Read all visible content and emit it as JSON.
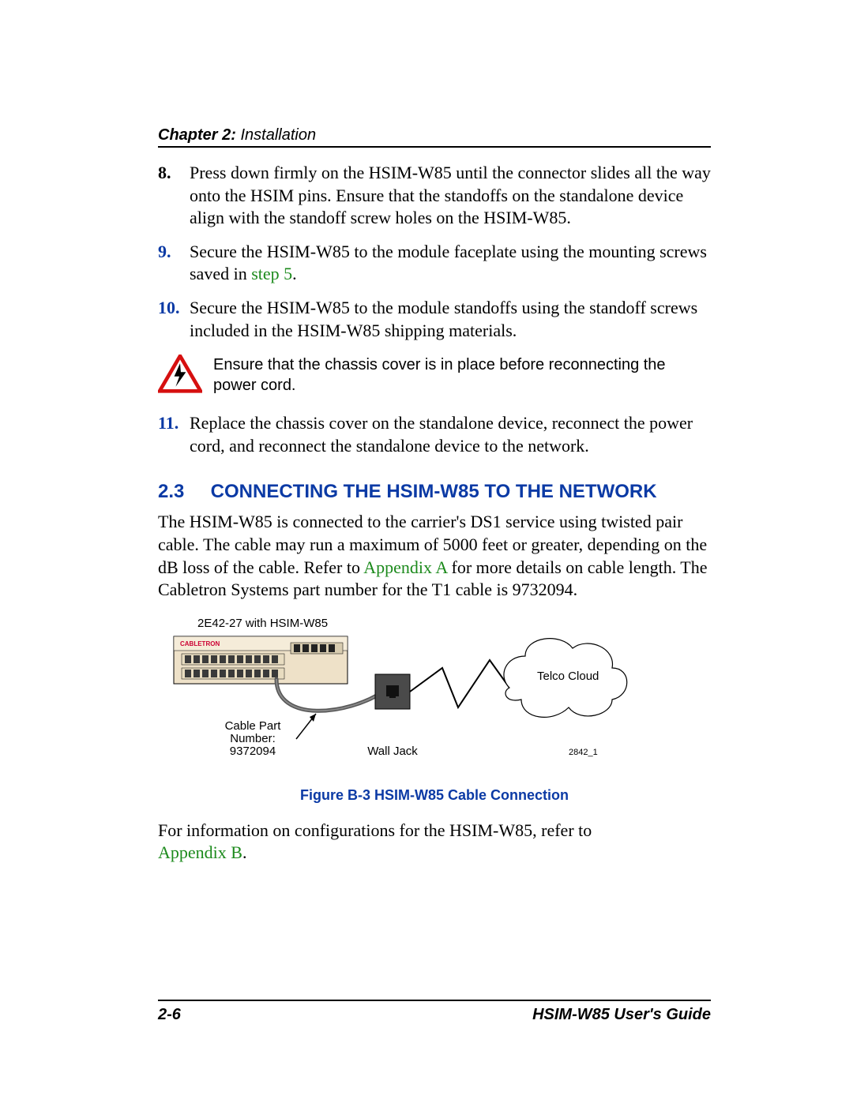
{
  "header": {
    "chapter": "Chapter 2:",
    "title": "Installation"
  },
  "steps": [
    {
      "num": "8.",
      "color": "black",
      "text": "Press down firmly on the HSIM-W85 until the connector slides all the way onto the HSIM pins. Ensure that the standoffs on the standalone device align with the standoff screw holes on the HSIM-W85."
    },
    {
      "num": "9.",
      "color": "blue",
      "text_before": "Secure the HSIM-W85 to the module faceplate using the mounting screws saved in ",
      "link": "step 5",
      "text_after": "."
    },
    {
      "num": "10.",
      "color": "blue",
      "text": "Secure the HSIM-W85 to the module standoffs using the standoff screws included in the HSIM-W85 shipping materials."
    }
  ],
  "warning": "Ensure that the chassis cover is in place before reconnecting the power cord.",
  "step11": {
    "num": "11.",
    "text": "Replace the chassis cover on the standalone device, reconnect the power cord, and reconnect the standalone device to the network."
  },
  "section": {
    "num": "2.3",
    "title": "CONNECTING THE HSIM-W85 TO THE NETWORK"
  },
  "section_para": {
    "before": "The HSIM-W85 is connected to the carrier's DS1 service using twisted pair cable. The cable may run a maximum of 5000 feet or greater, depending on the dB loss of the cable. Refer to ",
    "link": "Appendix A",
    "after": " for more details on cable length. The Cabletron Systems part number for the T1 cable is 9732094."
  },
  "figure": {
    "device_label": "2E42-27 with HSIM-W85",
    "cable_label_line1": "Cable Part",
    "cable_label_line2": "Number:",
    "cable_label_line3": "9372094",
    "wall_jack": "Wall Jack",
    "cloud": "Telco Cloud",
    "refnum": "2842_1",
    "caption": "Figure B-3   HSIM-W85 Cable Connection"
  },
  "closing": {
    "before": "For information on configurations for the HSIM-W85, refer to ",
    "link": "Appendix B",
    "after": "."
  },
  "footer": {
    "page": "2-6",
    "guide": "HSIM-W85 User's Guide"
  }
}
